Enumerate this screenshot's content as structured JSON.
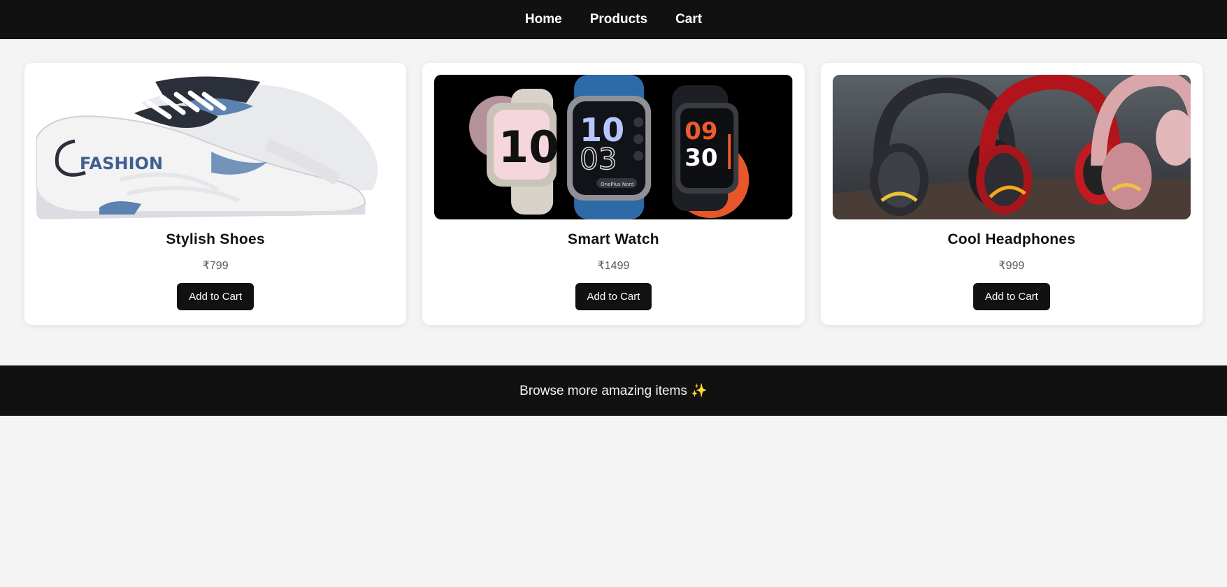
{
  "nav": {
    "links": [
      {
        "label": "Home"
      },
      {
        "label": "Products"
      },
      {
        "label": "Cart"
      }
    ]
  },
  "products": [
    {
      "name": "Stylish Shoes",
      "price": "₹799",
      "button": "Add to Cart",
      "image_text": "FASHION",
      "image": "sneaker-image"
    },
    {
      "name": "Smart Watch",
      "price": "₹1499",
      "button": "Add to Cart",
      "image_text": [
        "10",
        "10",
        "03",
        "09",
        "30",
        "OnePlus Nord"
      ],
      "image": "smartwatch-image"
    },
    {
      "name": "Cool Headphones",
      "price": "₹999",
      "button": "Add to Cart",
      "image": "headphones-image"
    }
  ],
  "footer": {
    "text": "Browse more amazing items ✨"
  },
  "colors": {
    "nav_bg": "#111111",
    "page_bg": "#f4f4f4",
    "card_bg": "#ffffff",
    "button_bg": "#111111"
  }
}
